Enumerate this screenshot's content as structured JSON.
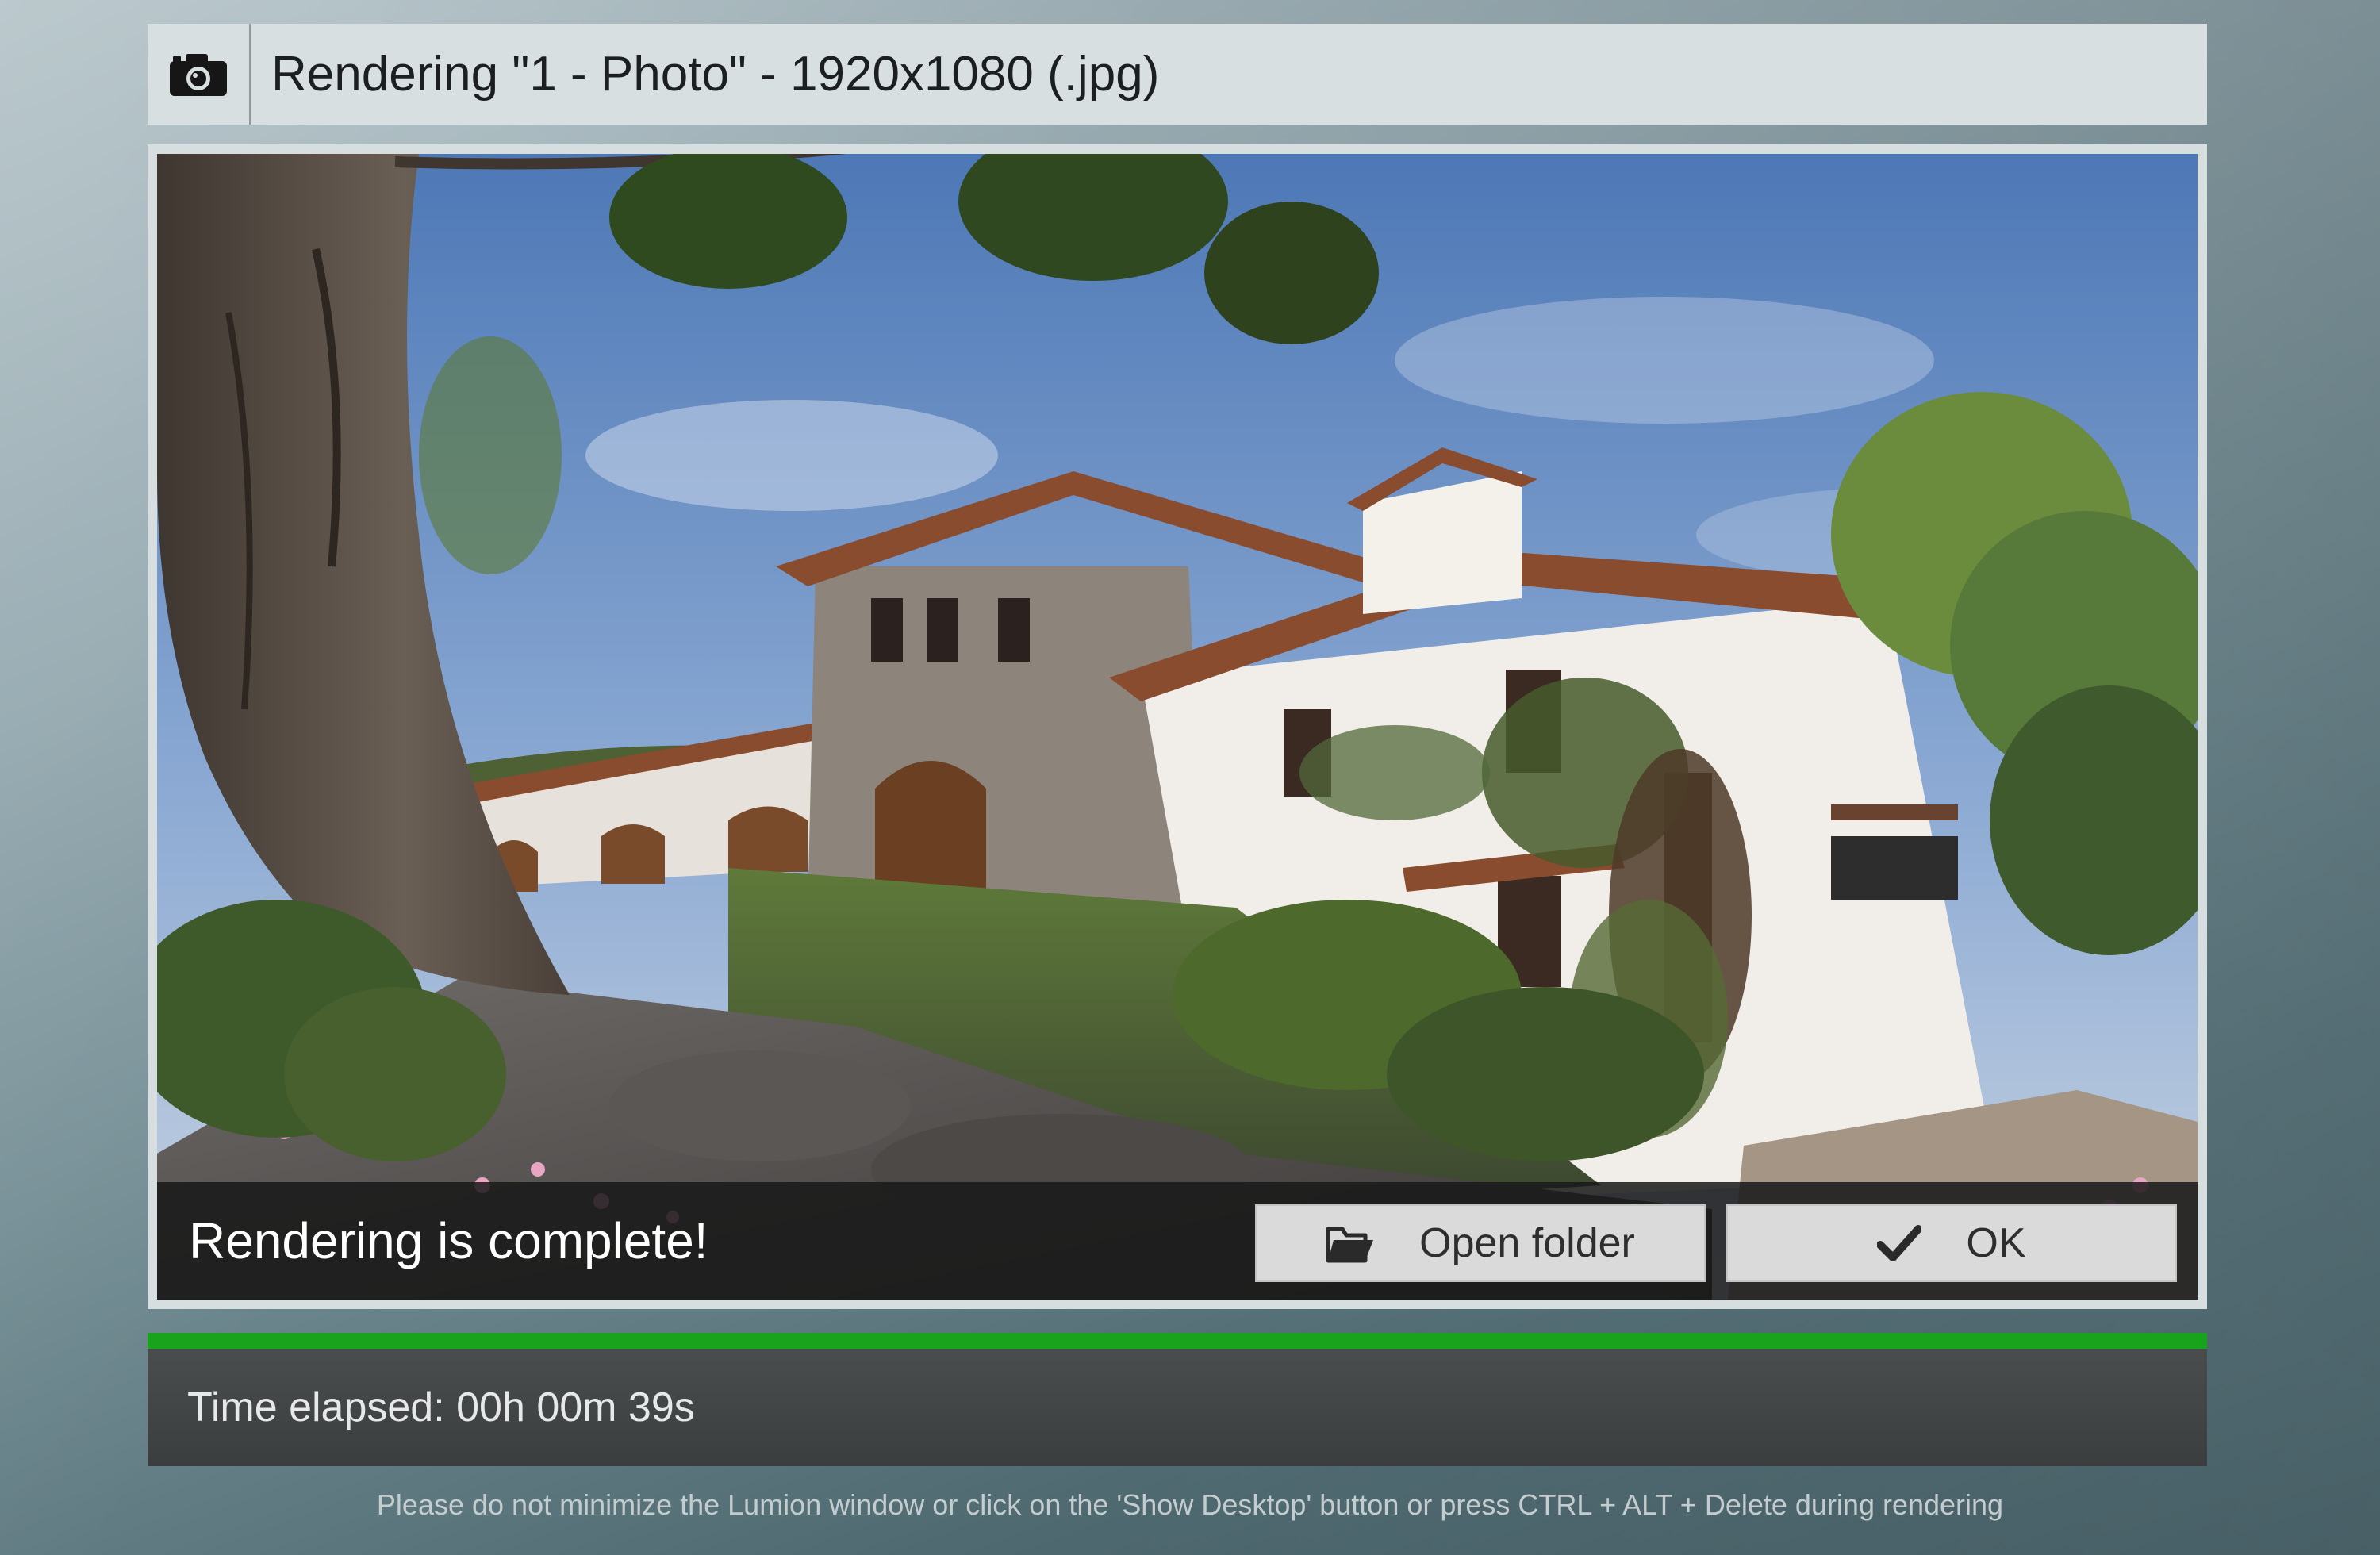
{
  "title_bar": {
    "icon": "camera-icon",
    "title": "Rendering \"1 - Photo\" - 1920x1080 (.jpg)"
  },
  "preview": {
    "status": "Rendering is complete!",
    "buttons": {
      "open_folder": {
        "label": "Open folder",
        "icon": "folder-open-icon"
      },
      "ok": {
        "label": "OK",
        "icon": "checkmark-icon"
      }
    }
  },
  "progress": {
    "fraction": 1.0,
    "color": "#19a21c",
    "time_elapsed": "Time elapsed: 00h 00m 39s"
  },
  "footer": {
    "note": "Please do not minimize the Lumion window or click on the 'Show Desktop' button or press CTRL + ALT + Delete during rendering"
  }
}
